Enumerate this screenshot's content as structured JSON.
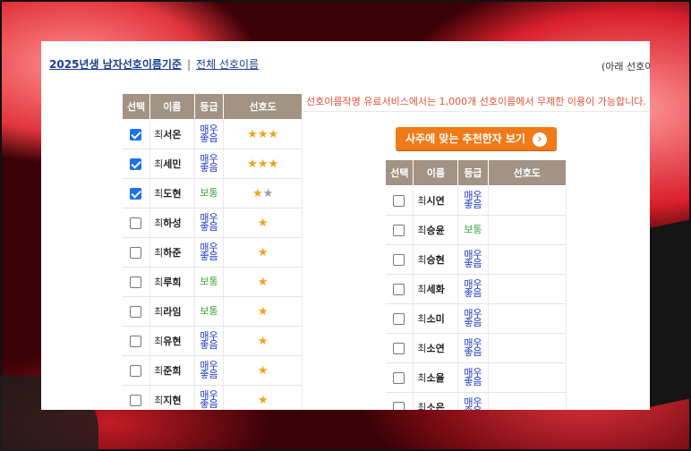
{
  "nav": {
    "link1": "2025년생 남자선호이름기준",
    "separator": "|",
    "link2": "전체 선호이름",
    "right_note": "(아래 선호이"
  },
  "promo_text": "선호이름작명 유료서비스에서는 1,000개 선호이름에서 무제한 이용이 가능합니다.",
  "recommend_button": "사주에 맞는 추천한자 보기",
  "table_headers": {
    "select": "선택",
    "name": "이름",
    "grade": "등급",
    "preference": "선호도"
  },
  "left_table": [
    {
      "checked": true,
      "surname": "최",
      "given": "서온",
      "grade": "매우좋음",
      "grade_lines": [
        "매우",
        "좋음"
      ],
      "stars_gold": 3,
      "stars_gray": 0
    },
    {
      "checked": true,
      "surname": "최",
      "given": "세민",
      "grade": "매우좋음",
      "grade_lines": [
        "매우",
        "좋음"
      ],
      "stars_gold": 3,
      "stars_gray": 0
    },
    {
      "checked": true,
      "surname": "최",
      "given": "도현",
      "grade": "보통",
      "grade_lines": [
        "보통"
      ],
      "stars_gold": 1,
      "stars_gray": 1
    },
    {
      "checked": false,
      "surname": "최",
      "given": "하성",
      "grade": "매우좋음",
      "grade_lines": [
        "매우",
        "좋음"
      ],
      "stars_gold": 1,
      "stars_gray": 0
    },
    {
      "checked": false,
      "surname": "최",
      "given": "하준",
      "grade": "매우좋음",
      "grade_lines": [
        "매우",
        "좋음"
      ],
      "stars_gold": 1,
      "stars_gray": 0
    },
    {
      "checked": false,
      "surname": "최",
      "given": "루희",
      "grade": "보통",
      "grade_lines": [
        "보통"
      ],
      "stars_gold": 1,
      "stars_gray": 0
    },
    {
      "checked": false,
      "surname": "최",
      "given": "라임",
      "grade": "보통",
      "grade_lines": [
        "보통"
      ],
      "stars_gold": 1,
      "stars_gray": 0
    },
    {
      "checked": false,
      "surname": "최",
      "given": "유현",
      "grade": "매우좋음",
      "grade_lines": [
        "매우",
        "좋음"
      ],
      "stars_gold": 1,
      "stars_gray": 0
    },
    {
      "checked": false,
      "surname": "최",
      "given": "준희",
      "grade": "매우좋음",
      "grade_lines": [
        "매우",
        "좋음"
      ],
      "stars_gold": 1,
      "stars_gray": 0
    },
    {
      "checked": false,
      "surname": "최",
      "given": "지현",
      "grade": "매우좋음",
      "grade_lines": [
        "매우",
        "좋음"
      ],
      "stars_gold": 1,
      "stars_gray": 0
    }
  ],
  "right_table": [
    {
      "checked": false,
      "surname": "최",
      "given": "시연",
      "grade": "매우좋음",
      "grade_lines": [
        "매우",
        "좋음"
      ]
    },
    {
      "checked": false,
      "surname": "최",
      "given": "승윤",
      "grade": "보통",
      "grade_lines": [
        "보통"
      ]
    },
    {
      "checked": false,
      "surname": "최",
      "given": "승현",
      "grade": "매우좋음",
      "grade_lines": [
        "매우",
        "좋음"
      ]
    },
    {
      "checked": false,
      "surname": "최",
      "given": "세화",
      "grade": "매우좋음",
      "grade_lines": [
        "매우",
        "좋음"
      ]
    },
    {
      "checked": false,
      "surname": "최",
      "given": "소미",
      "grade": "매우좋음",
      "grade_lines": [
        "매우",
        "좋음"
      ]
    },
    {
      "checked": false,
      "surname": "최",
      "given": "소연",
      "grade": "매우좋음",
      "grade_lines": [
        "매우",
        "좋음"
      ]
    },
    {
      "checked": false,
      "surname": "최",
      "given": "소율",
      "grade": "매우좋음",
      "grade_lines": [
        "매우",
        "좋음"
      ]
    },
    {
      "checked": false,
      "surname": "최",
      "given": "소은",
      "grade": "매우좋음",
      "grade_lines": [
        "매우",
        "좋음"
      ]
    }
  ]
}
